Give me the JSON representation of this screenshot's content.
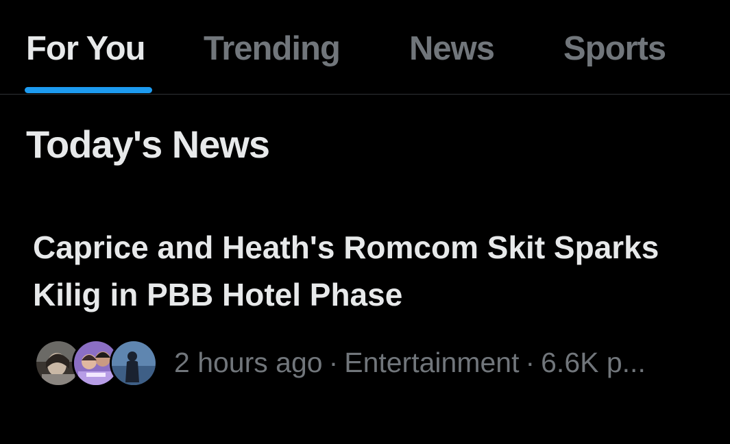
{
  "tabs": [
    {
      "label": "For You",
      "active": true
    },
    {
      "label": "Trending",
      "active": false
    },
    {
      "label": "News",
      "active": false
    },
    {
      "label": "Sports",
      "active": false
    }
  ],
  "colors": {
    "accent": "#1d9bf0",
    "text_primary": "#e7e9ea",
    "text_secondary": "#71767b",
    "background": "#000000"
  },
  "section": {
    "title": "Today's News"
  },
  "story": {
    "headline": "Caprice and Heath's Romcom Skit Sparks Kilig in PBB Hotel Phase",
    "time": "2 hours ago",
    "category": "Entertainment",
    "posts": "6.6K p...",
    "separator": "·",
    "avatars": [
      "avatar-photo",
      "avatar-photo",
      "avatar-photo"
    ]
  }
}
